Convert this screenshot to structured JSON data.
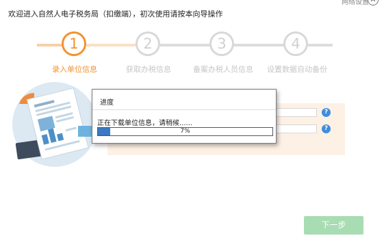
{
  "header": {
    "welcome_text": "欢迎进入自然人电子税务局（扣缴端），初次使用请按本向导操作",
    "network_settings_label": "网络设置",
    "close_glyph": "✕"
  },
  "wizard": {
    "active_step": 1,
    "accent_color": "#f29230",
    "inactive_color": "#d8d8d8",
    "steps": [
      {
        "number": "1",
        "label": "录入单位信息"
      },
      {
        "number": "2",
        "label": "获取办税信息"
      },
      {
        "number": "3",
        "label": "备案办税人员信息"
      },
      {
        "number": "4",
        "label": "设置数据自动备份"
      }
    ]
  },
  "form": {
    "help_glyph": "?"
  },
  "progress_dialog": {
    "title": "进度",
    "status": "正在下载单位信息，请稍候......",
    "percent": 7,
    "percent_label": "7%",
    "fill_color": "#3b79c2"
  },
  "footer": {
    "next_label": "下一步"
  }
}
